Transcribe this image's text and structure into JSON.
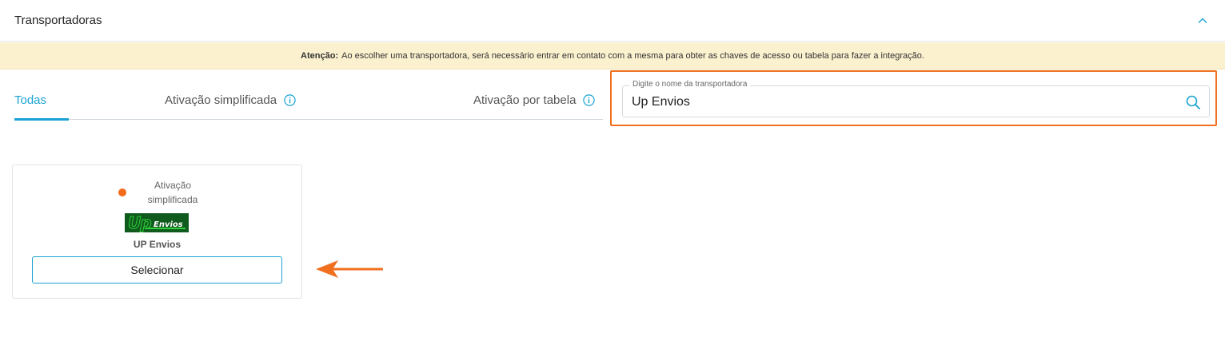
{
  "header": {
    "title": "Transportadoras",
    "collapse_icon": "chevron-up-icon"
  },
  "warning": {
    "label": "Atenção:",
    "message": "Ao escolher uma transportadora, será necessário entrar em contato com a mesma para obter as chaves de acesso ou tabela para fazer a integração."
  },
  "tabs": [
    {
      "label": "Todas",
      "active": true
    },
    {
      "label": "Ativação simplificada",
      "icon": "info-icon"
    },
    {
      "label": "Ativação por tabela",
      "icon": "info-icon"
    }
  ],
  "search": {
    "label": "Digite o nome da transportadora",
    "value": "Up Envios",
    "icon": "search-icon"
  },
  "carriers": [
    {
      "status": "Ativação simplificada",
      "status_color": "#f26a1b",
      "logo_text_main": "Up",
      "logo_text_sub": "Envios",
      "name": "UP Envios",
      "button_label": "Selecionar"
    }
  ],
  "colors": {
    "accent": "#1aa3d4",
    "highlight": "#f07020",
    "warning_bg": "#fbf1cf"
  }
}
